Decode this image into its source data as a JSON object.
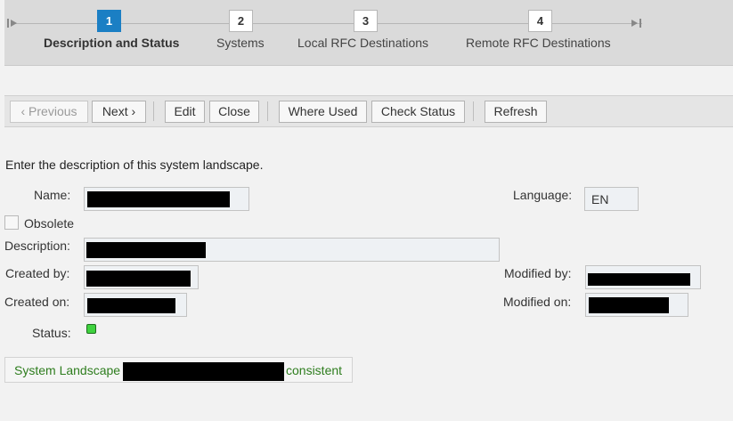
{
  "roadmap": {
    "steps": [
      {
        "number": "1",
        "label": "Description and Status",
        "active": true
      },
      {
        "number": "2",
        "label": "Systems",
        "active": false
      },
      {
        "number": "3",
        "label": "Local RFC Destinations",
        "active": false
      },
      {
        "number": "4",
        "label": "Remote RFC Destinations",
        "active": false
      }
    ],
    "start_icon": "roadmap-start-icon",
    "end_icon": "roadmap-end-icon"
  },
  "toolbar": {
    "previous": "Previous",
    "previous_arrow": "‹",
    "next": "Next",
    "next_arrow": "›",
    "edit": "Edit",
    "close": "Close",
    "where_used": "Where Used",
    "check_status": "Check Status",
    "refresh": "Refresh"
  },
  "form": {
    "intro": "Enter the description of this system landscape.",
    "name_label": "Name:",
    "language_label": "Language:",
    "language_value": "EN",
    "obsolete_label": "Obsolete",
    "description_label": "Description:",
    "created_by_label": "Created by:",
    "modified_by_label": "Modified by:",
    "created_on_label": "Created on:",
    "modified_on_label": "Modified on:",
    "status_label": "Status:"
  },
  "message": {
    "prefix": "System Landscape",
    "suffix": "consistent"
  },
  "colors": {
    "active_step": "#1b7fc4",
    "status_ok": "#3fd23f",
    "message_text": "#2e7d1e"
  }
}
